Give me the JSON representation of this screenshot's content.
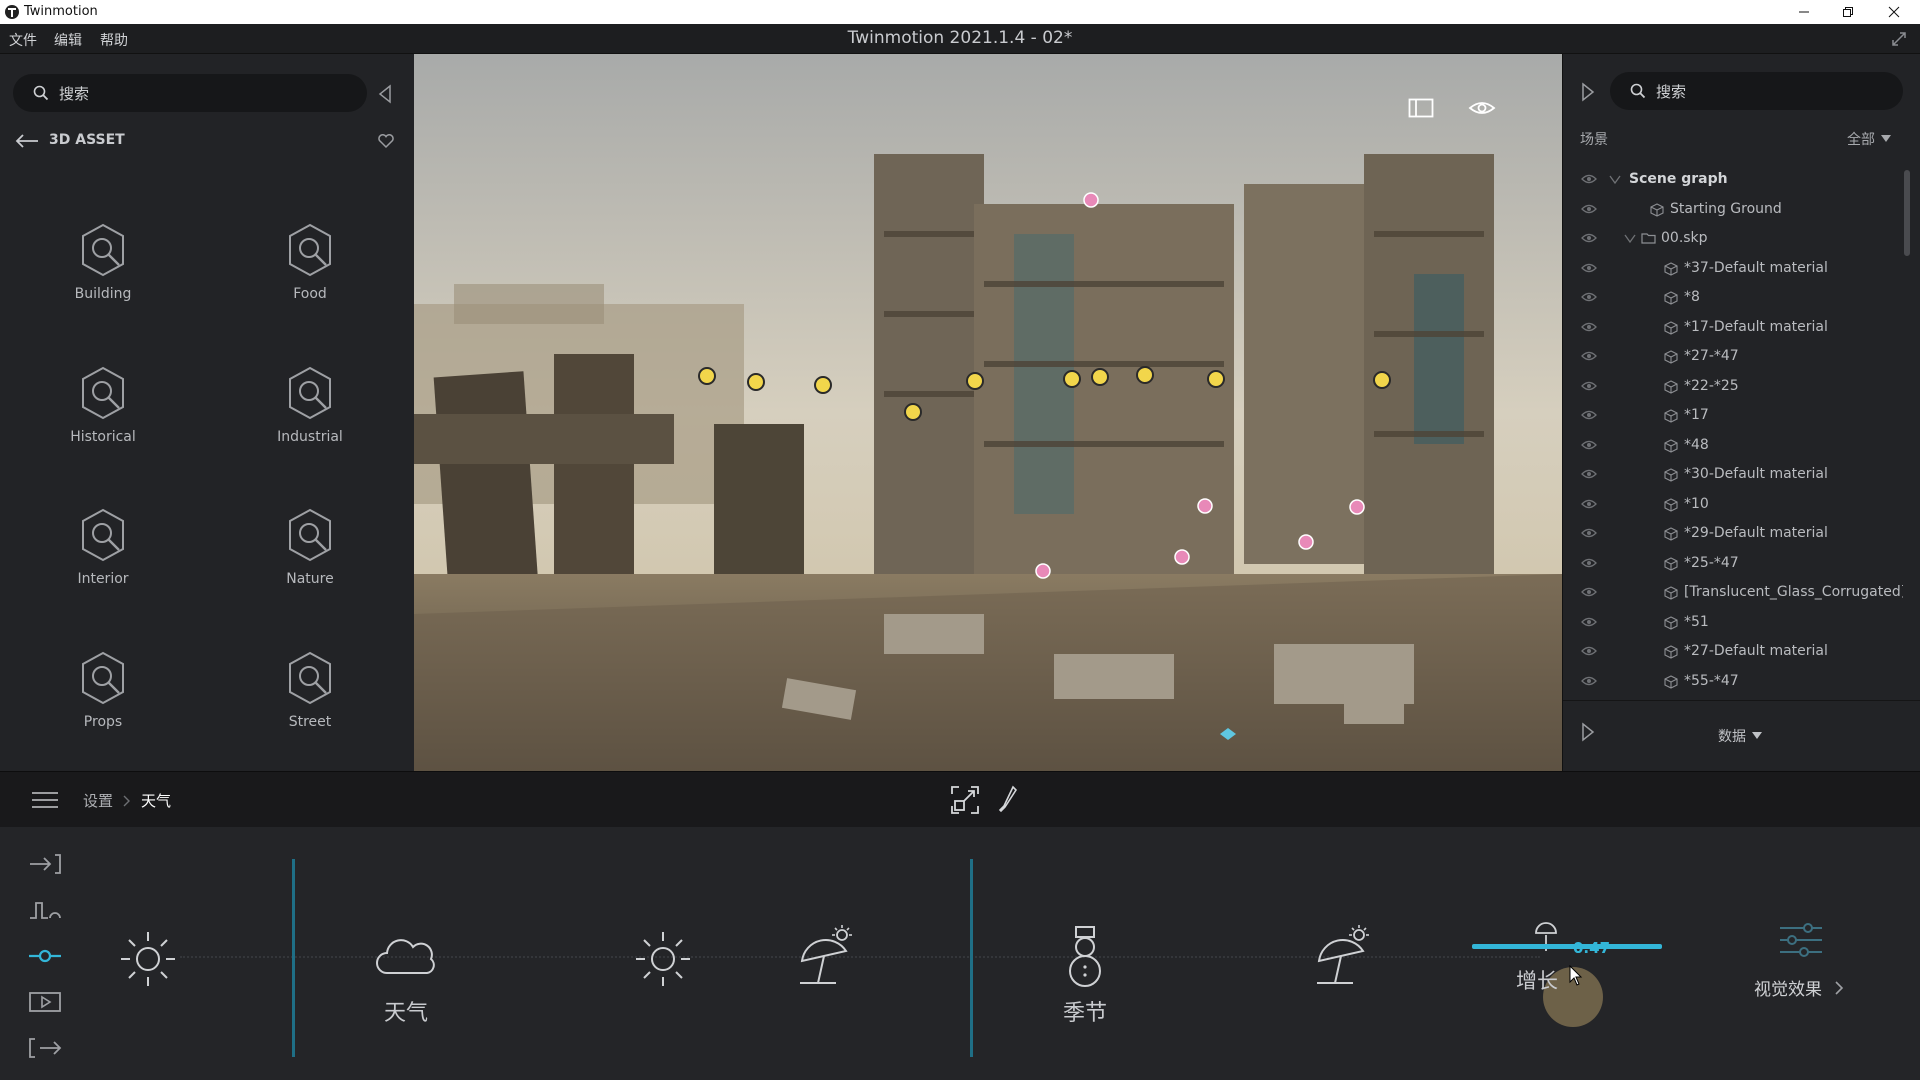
{
  "window": {
    "app_name": "Twinmotion",
    "doc_title": "Twinmotion 2021.1.4 - 02*"
  },
  "menu": {
    "items": [
      "文件",
      "编辑",
      "帮助"
    ]
  },
  "library": {
    "search_placeholder": "搜索",
    "section_title": "3D ASSET",
    "categories": [
      "Building",
      "Food",
      "Historical",
      "Industrial",
      "Interior",
      "Nature",
      "Props",
      "Street"
    ]
  },
  "scene": {
    "search_placeholder": "搜索",
    "header_label": "场景",
    "filter_label": "全部",
    "tree": [
      {
        "label": "Scene graph",
        "level": 0,
        "kind": "root"
      },
      {
        "label": "Starting Ground",
        "level": 1,
        "kind": "object"
      },
      {
        "label": "00.skp",
        "level": 1,
        "kind": "folder"
      },
      {
        "label": "*37-Default material",
        "level": 2,
        "kind": "object"
      },
      {
        "label": "*8",
        "level": 2,
        "kind": "object"
      },
      {
        "label": "*17-Default material",
        "level": 2,
        "kind": "object"
      },
      {
        "label": "*27-*47",
        "level": 2,
        "kind": "object"
      },
      {
        "label": "*22-*25",
        "level": 2,
        "kind": "object"
      },
      {
        "label": "*17",
        "level": 2,
        "kind": "object"
      },
      {
        "label": "*48",
        "level": 2,
        "kind": "object"
      },
      {
        "label": "*30-Default material",
        "level": 2,
        "kind": "object"
      },
      {
        "label": "*10",
        "level": 2,
        "kind": "object"
      },
      {
        "label": "*29-Default material",
        "level": 2,
        "kind": "object"
      },
      {
        "label": "*25-*47",
        "level": 2,
        "kind": "object"
      },
      {
        "label": "[Translucent_Glass_Corrugated]",
        "level": 2,
        "kind": "object"
      },
      {
        "label": "*51",
        "level": 2,
        "kind": "object"
      },
      {
        "label": "*27-Default material",
        "level": 2,
        "kind": "object"
      },
      {
        "label": "*55-*47",
        "level": 2,
        "kind": "object"
      }
    ],
    "data_label": "数据"
  },
  "breadcrumb": {
    "root": "设置",
    "current": "天气"
  },
  "bottom": {
    "weather_label": "天气",
    "season_label": "季节",
    "growth_label": "增长",
    "growth_value": "0.47",
    "visual_label": "视觉效果"
  },
  "colors": {
    "accent": "#33b6d8",
    "panel": "#222326",
    "bottom": "#242528"
  }
}
